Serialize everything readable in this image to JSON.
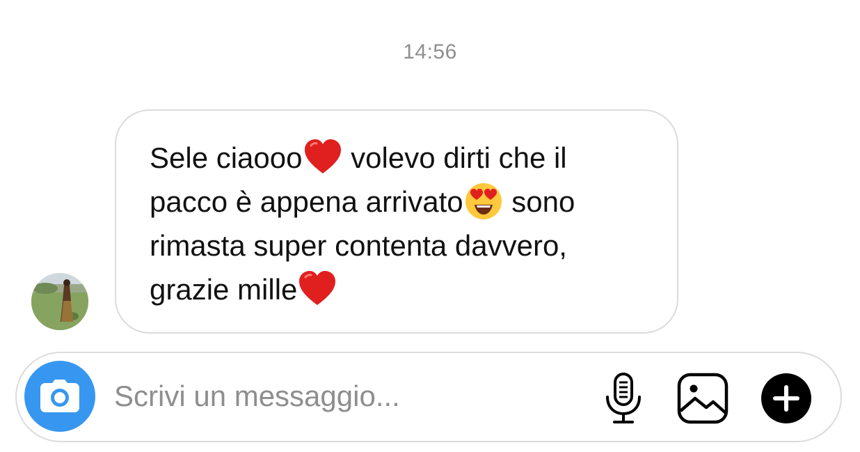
{
  "thread": {
    "timestamp": "14:56"
  },
  "message": {
    "sender_avatar": "avatar-photo",
    "segments": [
      {
        "type": "text",
        "value": "Sele ciaooo"
      },
      {
        "type": "emoji",
        "icon": "red-heart-emoji"
      },
      {
        "type": "text",
        "value": " volevo dirti che il pacco è appena arrivato"
      },
      {
        "type": "emoji",
        "icon": "heart-eyes-emoji"
      },
      {
        "type": "text",
        "value": " sono rimasta super contenta davvero, grazie mille"
      },
      {
        "type": "emoji",
        "icon": "red-heart-emoji"
      }
    ]
  },
  "composer": {
    "placeholder": "Scrivi un messaggio...",
    "value": "",
    "icons": {
      "camera": "camera-icon",
      "mic": "microphone-icon",
      "gallery": "image-gallery-icon",
      "plus": "plus-icon"
    }
  },
  "colors": {
    "camera_button": "#3797f0",
    "bubble_border": "#dbdbdb",
    "timestamp_text": "#8e8e8e",
    "placeholder_text": "#8e8e8e",
    "heart": "#e0201f"
  }
}
